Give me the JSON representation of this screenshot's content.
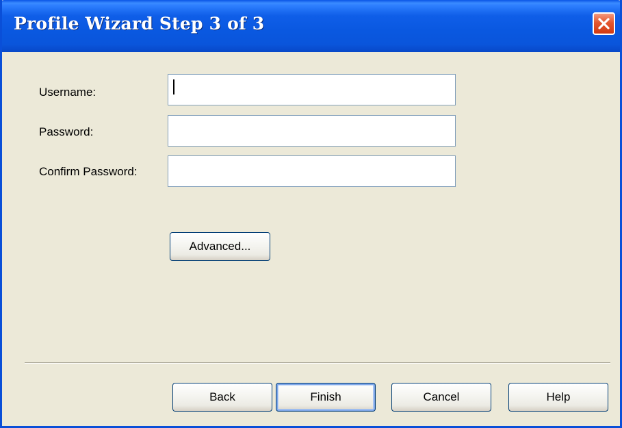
{
  "window": {
    "title": "Profile Wizard Step 3 of 3",
    "close_icon": "close-icon"
  },
  "form": {
    "username_label": "Username:",
    "username_value": "",
    "password_label": "Password:",
    "password_value": "",
    "confirm_label": "Confirm Password:",
    "confirm_value": ""
  },
  "advanced_label": "Advanced...",
  "footer": {
    "back_label": "Back",
    "finish_label": "Finish",
    "cancel_label": "Cancel",
    "help_label": "Help"
  },
  "colors": {
    "titlebar": "#0a55e6",
    "dialog_bg": "#ece9d8",
    "close_button": "#e4562f",
    "field_border": "#7f9db9"
  }
}
